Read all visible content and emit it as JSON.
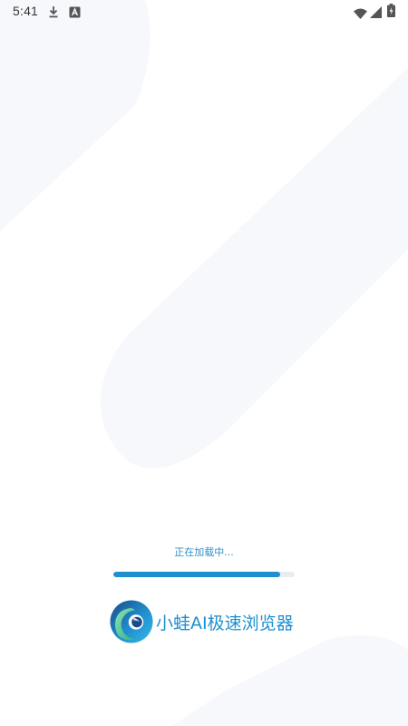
{
  "status_bar": {
    "time": "5:41",
    "left_icons": [
      "download-icon",
      "a-icon"
    ],
    "right_icons": [
      "wifi-icon",
      "signal-icon",
      "battery-charging-icon"
    ]
  },
  "loading": {
    "text": "正在加载中...",
    "progress_fraction": 0.92
  },
  "brand": {
    "app_name": "小蛙AI极速浏览器",
    "logo_icon": "frog-browser-logo-icon",
    "accent_color": "#1e8fcf"
  },
  "colors": {
    "background": "#ffffff",
    "background_shapes": "#f6f8fa",
    "progress_fill": "#1f8fce",
    "progress_track": "#e9edf1"
  }
}
